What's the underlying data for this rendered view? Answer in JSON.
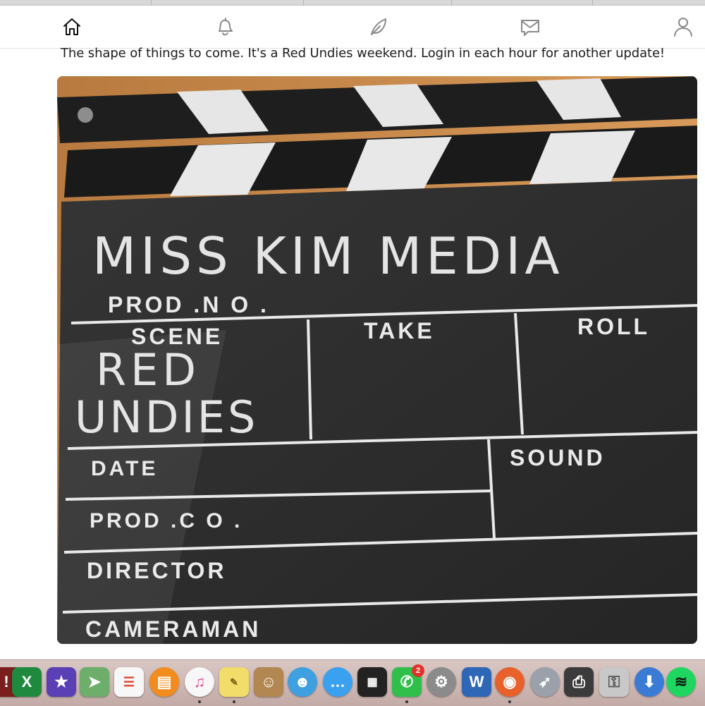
{
  "caption": "The shape of things to come. It's a Red Undies weekend. Login in each hour for another update!",
  "nav": [
    {
      "icon": "home-icon"
    },
    {
      "icon": "bell-icon"
    },
    {
      "icon": "leaf-icon"
    },
    {
      "icon": "mail-icon"
    },
    {
      "icon": "profile-icon"
    }
  ],
  "photo": {
    "handwritten": {
      "line1": "MISS KIM MEDIA",
      "line2": "RED",
      "line3": "UNDIES"
    },
    "slate_labels": {
      "prod_no": "PROD .N O .",
      "scene": "SCENE",
      "take": "TAKE",
      "roll": "ROLL",
      "date": "DATE",
      "sound": "SOUND",
      "prod_co": "PROD .C O .",
      "director": "DIRECTOR",
      "cameraman": "CAMERAMAN"
    }
  },
  "dock": {
    "messages_badge": "2",
    "apps": [
      "unknown-app",
      "excel",
      "imovie",
      "maps",
      "reminders",
      "ibooks",
      "itunes",
      "stickies",
      "contacts",
      "messenger",
      "messages",
      "photo-booth",
      "facetime",
      "system-preferences",
      "word",
      "firefox",
      "launchpad",
      "printer",
      "keychain",
      "downloader",
      "spotify"
    ]
  }
}
